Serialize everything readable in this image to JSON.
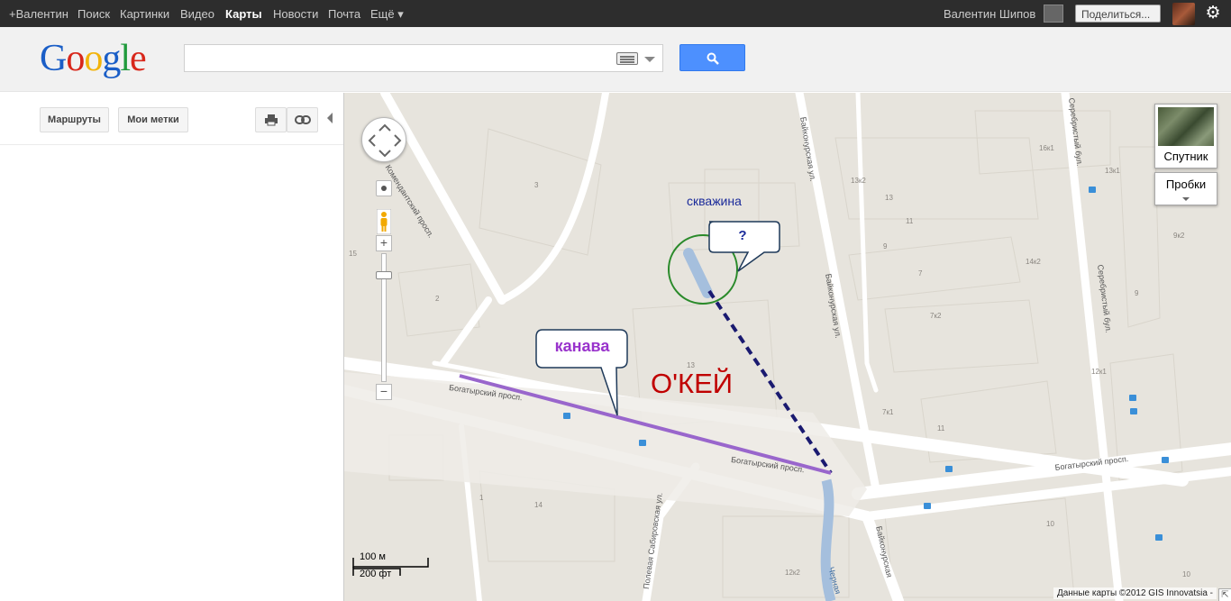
{
  "topbar": {
    "links": [
      "+Валентин",
      "Поиск",
      "Картинки",
      "Видео",
      "Карты",
      "Новости",
      "Почта",
      "Ещё ▾"
    ],
    "active_link": "Карты",
    "user_name": "Валентин Шипов",
    "share_label": "Поделиться..."
  },
  "header": {
    "logo": [
      "G",
      "o",
      "o",
      "g",
      "l",
      "e"
    ],
    "search_placeholder": ""
  },
  "left_panel": {
    "routes_button": "Маршруты",
    "my_places_button": "Мои метки"
  },
  "map": {
    "satellite_label": "Спутник",
    "traffic_label": "Пробки",
    "scale_m": "100 м",
    "scale_ft": "200 фт",
    "attribution": "Данные карты ©2012 GIS Innovatsia -",
    "streets": [
      "Комендантский просп.",
      "Байконурская ул.",
      "Байконурская ул.",
      "Серебристый бул.",
      "Серебристый бул.",
      "Богатырский просп.",
      "Богатырский просп.",
      "Богатырский просп.",
      "Полевая Сабировская ул.",
      "Байконурская",
      "Черная"
    ],
    "house_numbers": [
      "3",
      "15",
      "2",
      "13",
      "16к1",
      "13к1",
      "13к2",
      "13",
      "11",
      "9",
      "14к2",
      "9к2",
      "7",
      "7к2",
      "9",
      "12к1",
      "7к1",
      "11",
      "10",
      "14",
      "12к2",
      "10",
      "1"
    ],
    "annotations": {
      "well_label": "скважина",
      "question_label": "?",
      "ditch_label": "канава",
      "store_label": "О'КЕЙ"
    }
  }
}
